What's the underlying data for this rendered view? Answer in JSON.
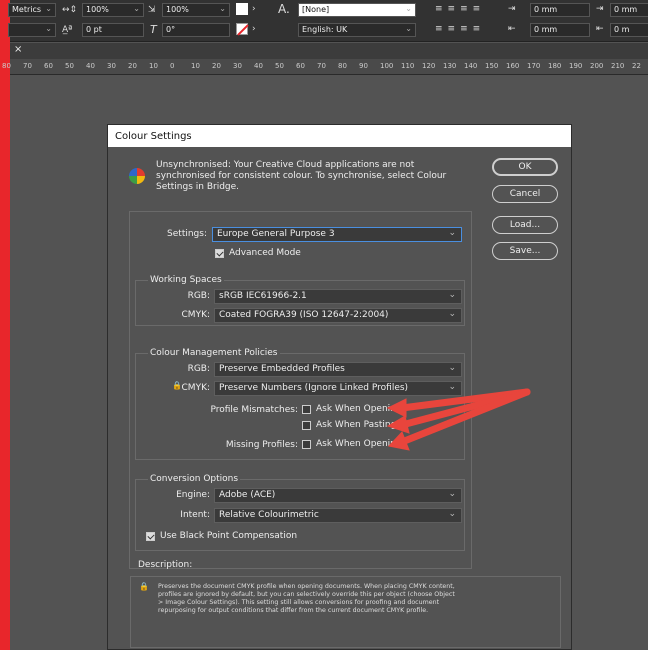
{
  "toolbar": {
    "row1": {
      "font_style": "Metrics",
      "tracking": "100%",
      "scale": "100%",
      "language_style": "[None]",
      "mm1": "0 mm",
      "mm2": "0 mm"
    },
    "row2": {
      "baseline": "0 pt",
      "skew": "0°",
      "language": "English: UK",
      "mm3": "0 mm",
      "mm4": "0 m"
    }
  },
  "tab_close": "×",
  "ruler_ticks": [
    "80",
    "70",
    "60",
    "50",
    "40",
    "30",
    "20",
    "10",
    "0",
    "10",
    "20",
    "30",
    "40",
    "50",
    "60",
    "70",
    "80",
    "90",
    "100",
    "110",
    "120",
    "130",
    "140",
    "150",
    "160",
    "170",
    "180",
    "190",
    "200",
    "210",
    "22"
  ],
  "dialog": {
    "title": "Colour Settings",
    "message": "Unsynchronised: Your Creative Cloud applications are not synchronised for consistent colour. To synchronise, select Colour Settings in Bridge.",
    "buttons": {
      "ok": "OK",
      "cancel": "Cancel",
      "load": "Load...",
      "save": "Save..."
    },
    "settings_label": "Settings:",
    "settings_value": "Europe General Purpose 3",
    "advanced_mode": "Advanced Mode",
    "working_spaces": {
      "title": "Working Spaces",
      "rgb_label": "RGB:",
      "rgb_value": "sRGB IEC61966-2.1",
      "cmyk_label": "CMYK:",
      "cmyk_value": "Coated FOGRA39 (ISO 12647-2:2004)"
    },
    "policies": {
      "title": "Colour Management Policies",
      "rgb_label": "RGB:",
      "rgb_value": "Preserve Embedded Profiles",
      "cmyk_label": "CMYK:",
      "cmyk_value": "Preserve Numbers (Ignore Linked Profiles)",
      "mismatch_label": "Profile Mismatches:",
      "ask_opening": "Ask When Opening",
      "ask_pasting": "Ask When Pasting",
      "missing_label": "Missing Profiles:",
      "missing_ask": "Ask When Opening"
    },
    "conversion": {
      "title": "Conversion Options",
      "engine_label": "Engine:",
      "engine_value": "Adobe (ACE)",
      "intent_label": "Intent:",
      "intent_value": "Relative Colourimetric",
      "black_point": "Use Black Point Compensation"
    },
    "description_title": "Description:",
    "description": "Preserves the document CMYK profile when opening documents. When placing CMYK content, profiles are ignored by default, but you can selectively override this per object (choose Object > Image Colour Settings). This setting still allows conversions for proofing and document repurposing for output conditions that differ from the current document CMYK profile."
  },
  "colors": {
    "annotation_arrow": "#e8453c",
    "frame": "#e8262b"
  }
}
